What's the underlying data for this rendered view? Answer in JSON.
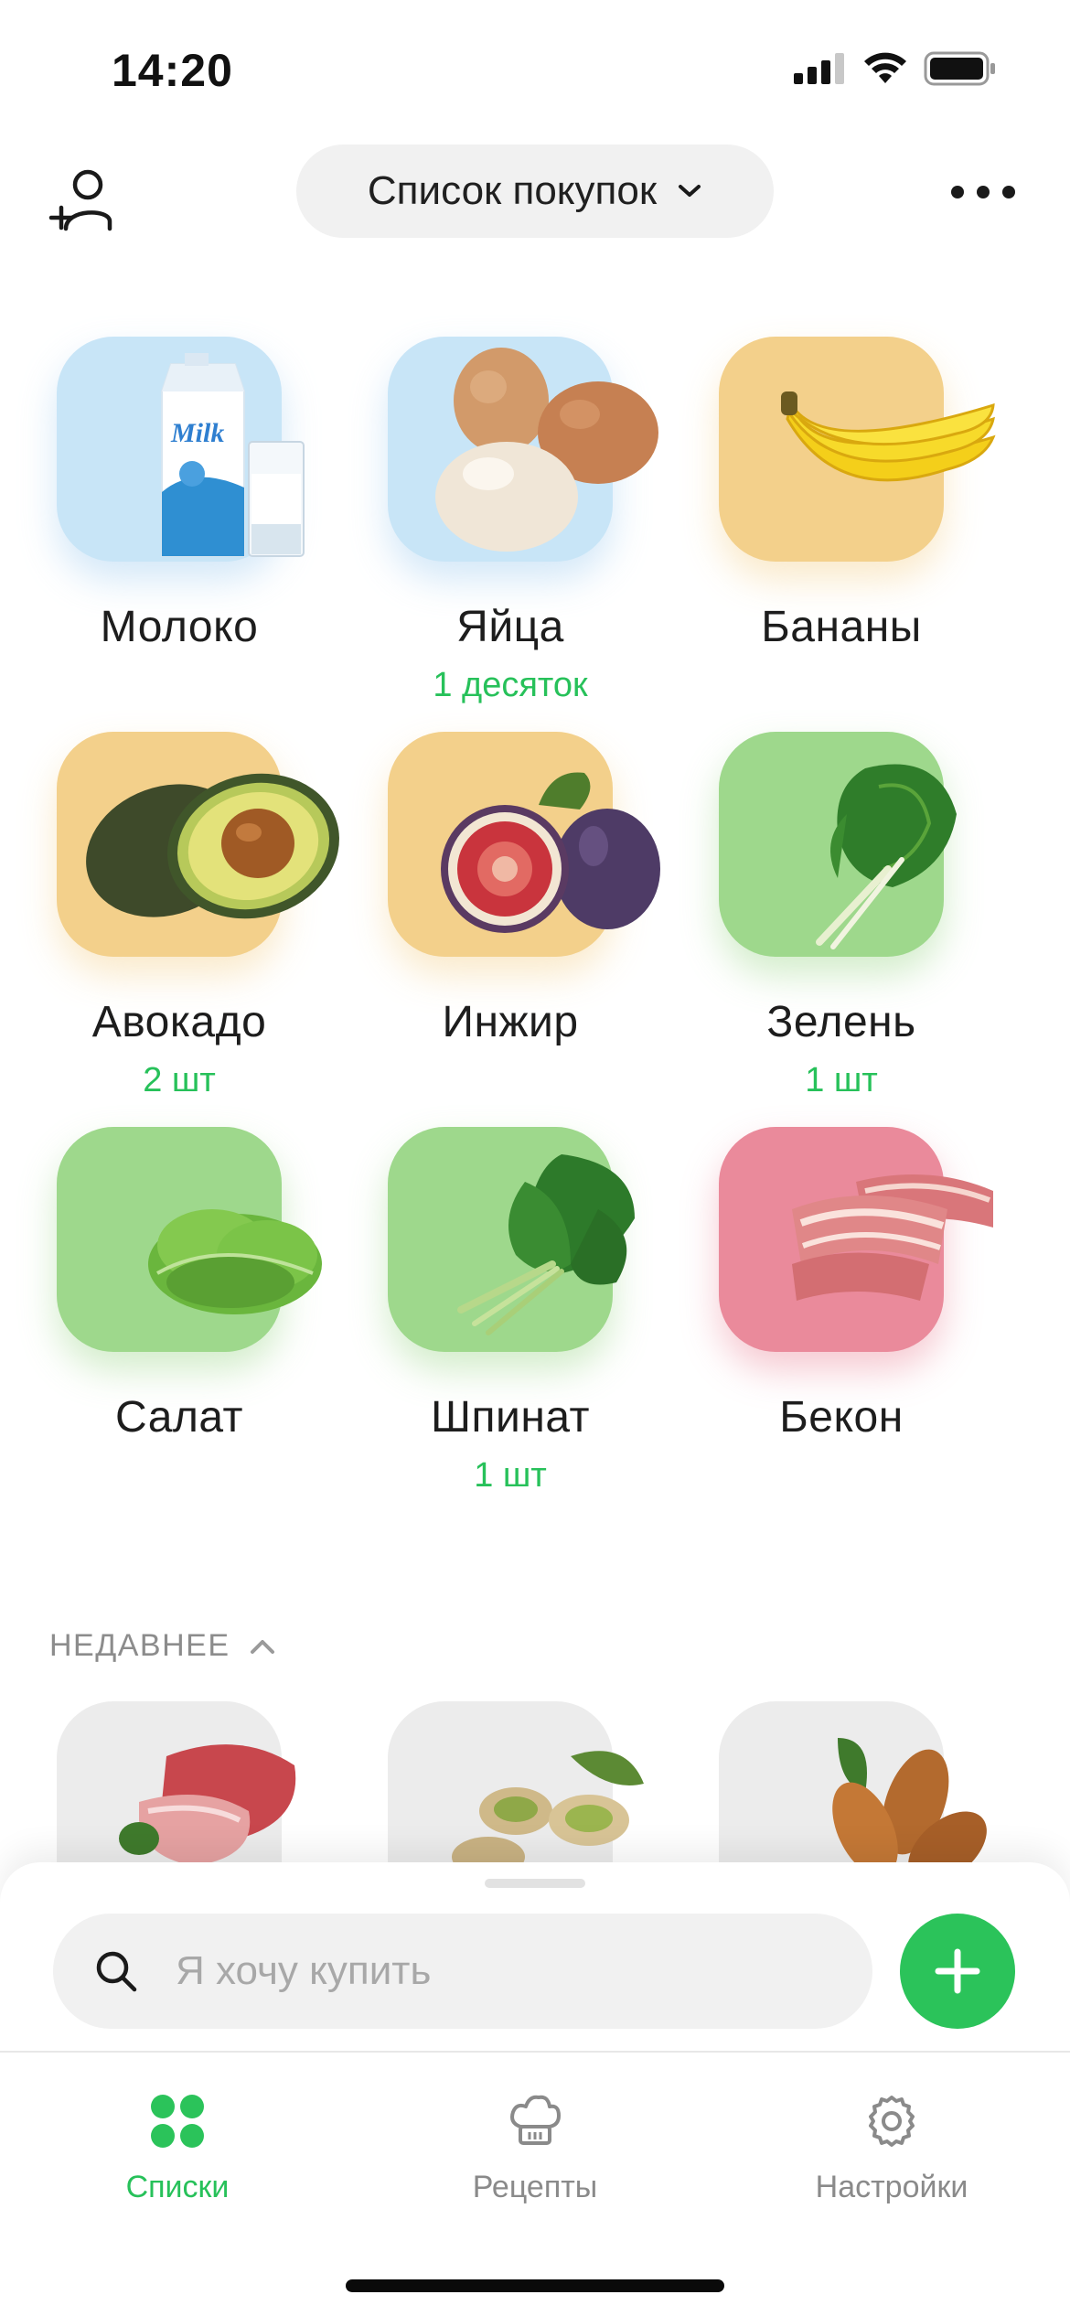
{
  "status_bar": {
    "time": "14:20"
  },
  "header": {
    "list_title": "Список покупок"
  },
  "items": [
    {
      "name": "Молоко",
      "qty": "",
      "icon": "milk-icon",
      "tile_color": "#c8e5f7"
    },
    {
      "name": "Яйца",
      "qty": "1 десяток",
      "icon": "eggs-icon",
      "tile_color": "#c8e5f7"
    },
    {
      "name": "Бананы",
      "qty": "",
      "icon": "banana-icon",
      "tile_color": "#f3d08b"
    },
    {
      "name": "Авокадо",
      "qty": "2 шт",
      "icon": "avocado-icon",
      "tile_color": "#f3d08b"
    },
    {
      "name": "Инжир",
      "qty": "",
      "icon": "fig-icon",
      "tile_color": "#f3d08b"
    },
    {
      "name": "Зелень",
      "qty": "1 шт",
      "icon": "chard-icon",
      "tile_color": "#9ed88c"
    },
    {
      "name": "Салат",
      "qty": "",
      "icon": "lettuce-icon",
      "tile_color": "#9ed88c"
    },
    {
      "name": "Шпинат",
      "qty": "1 шт",
      "icon": "spinach-icon",
      "tile_color": "#9ed88c"
    },
    {
      "name": "Бекон",
      "qty": "",
      "icon": "bacon-icon",
      "tile_color": "#ea8a9b"
    }
  ],
  "recent": {
    "label": "НЕДАВНЕЕ",
    "items": [
      {
        "icon": "meat-icon"
      },
      {
        "icon": "pistachio-icon"
      },
      {
        "icon": "almond-icon"
      }
    ]
  },
  "search": {
    "placeholder": "Я хочу купить"
  },
  "tabs": [
    {
      "label": "Списки",
      "icon": "grid-icon",
      "active": true
    },
    {
      "label": "Рецепты",
      "icon": "chef-hat-icon",
      "active": false
    },
    {
      "label": "Настройки",
      "icon": "gear-icon",
      "active": false
    }
  ],
  "colors": {
    "accent": "#2bc35a",
    "accent_text": "#27c15a"
  }
}
